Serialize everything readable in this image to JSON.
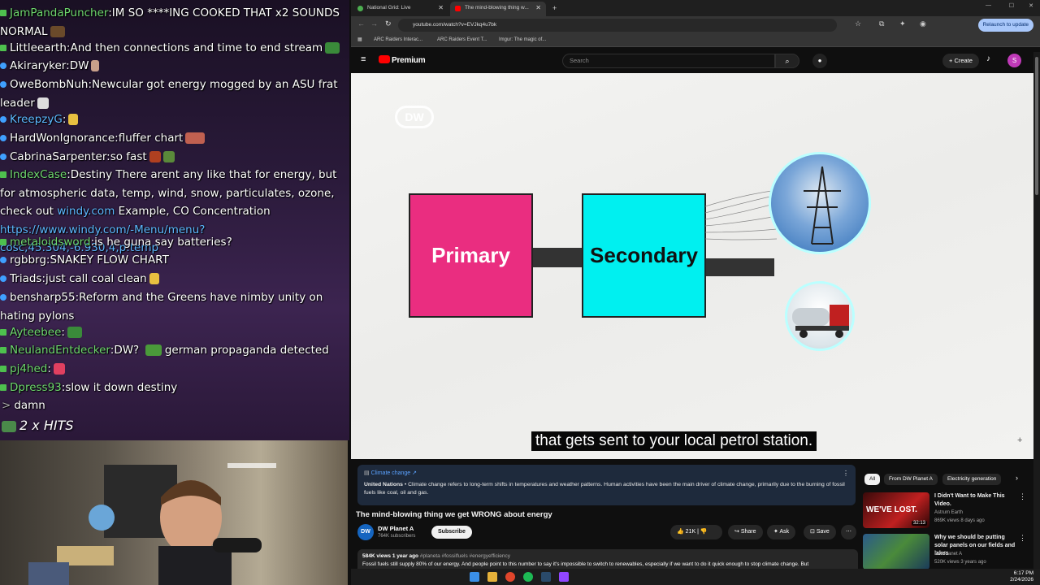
{
  "chat": {
    "messages": [
      {
        "user": "JamPandaPuncher",
        "text": "IM SO ****ING COOKED THAT x2 SOUNDS NORMAL",
        "color": "#6ed86e"
      },
      {
        "user": "Littleearth",
        "text": "And then connections and time to end stream",
        "color": "#ffffff"
      },
      {
        "user": "Akiraryker",
        "text": "DW",
        "color": "#ffffff"
      },
      {
        "user": "OweBombNuh",
        "text": "Newcular got energy mogged by an ASU frat leader",
        "color": "#ffffff"
      },
      {
        "user": "KreepzyG",
        "text": "",
        "color": "#5cb8ff"
      },
      {
        "user": "HardWonIgnorance",
        "text": "fluffer chart",
        "color": "#ffffff"
      },
      {
        "user": "CabrinaSarpenter",
        "text": "so fast",
        "color": "#ffffff"
      },
      {
        "user": "IndexCase",
        "text": "Destiny There arent any like that for energy, but for atmospheric data, temp, wind, snow, particulates, ozone, check out",
        "link1": "windy.com",
        "text2": "Example, CO Concentration",
        "link2": "https://www.windy.com/-Menu/menu?cosc,45.304,-6.930,4,p:temp",
        "color": "#6ed86e"
      },
      {
        "user": "metaloidsword",
        "text": "is he guna say batteries?",
        "color": "#6ed86e"
      },
      {
        "user": "rgbbrg",
        "text": "SNAKEY FLOW CHART",
        "color": "#ffffff"
      },
      {
        "user": "Triads",
        "text": "just call coal clean",
        "color": "#ffffff"
      },
      {
        "user": "bensharp55",
        "text": "Reform and the Greens have nimby unity on hating pylons",
        "color": "#ffffff"
      },
      {
        "user": "Ayteebee",
        "text": "",
        "color": "#6ed86e"
      },
      {
        "user": "NeulandEntdecker",
        "text": "DW?",
        "text2": "german propaganda detected",
        "color": "#6ed86e"
      },
      {
        "user": "pj4hed",
        "text": "",
        "color": "#6ed86e"
      },
      {
        "user": "Dpress93",
        "text": "slow it down destiny",
        "color": "#6ed86e"
      },
      {
        "user": "",
        "text": "damn",
        "color": "#ffffff"
      }
    ],
    "hits": "2 x HITS"
  },
  "browser": {
    "tabs": [
      "National Grid: Live",
      "The mind-blowing thing w..."
    ],
    "new_tab": "+",
    "url": "youtube.com/watch?v=EVJkq4u7bk",
    "relaunch": "Relaunch to update",
    "bookmarks": [
      "ARC Raiders Interac...",
      "ARC Raiders Event T...",
      "Imgur: The magic of..."
    ]
  },
  "youtube": {
    "logo": "Premium",
    "search_placeholder": "Search",
    "create": "Create",
    "avatar": "S",
    "video": {
      "watermark": "DW",
      "primary": "Primary",
      "secondary": "Secondary",
      "subtitle": "that gets sent to your local petrol station."
    },
    "info_panel": {
      "heading": "Climate change",
      "source": "United Nations",
      "text": "Climate change refers to long-term shifts in temperatures and weather patterns. Human activities have been the main driver of climate change, primarily due to the burning of fossil fuels like coal, oil and gas."
    },
    "title": "The mind-blowing thing we get WRONG about energy",
    "channel": {
      "logo": "DW",
      "name": "DW Planet A",
      "subs": "764K subscribers",
      "subscribe": "Subscribe"
    },
    "actions": {
      "likes": "21K",
      "share": "Share",
      "ask": "Ask",
      "save": "Save"
    },
    "description": {
      "meta": "584K views  1 year ago",
      "tags": "#planeta #fossilfuels #energyefficiency",
      "text": "Fossil fuels still supply 80% of our energy. And people point to this number to say it's impossible to switch to renewables, especially if we want to do it quick enough to stop climate change. But"
    },
    "chips": [
      "All",
      "From DW Planet A",
      "Electricity generation"
    ],
    "recommended": [
      {
        "title": "I Didn't Want to Make This Video.",
        "channel": "Astrum Earth",
        "meta": "869K views  8 days ago",
        "duration": "32:13",
        "thumb_text": "WE'VE LOST."
      },
      {
        "title": "Why we should be putting solar panels on our fields and lakes",
        "channel": "DW Planet A",
        "meta": "520K views  3 years ago",
        "duration": "",
        "thumb_text": ""
      }
    ]
  },
  "taskbar": {
    "time": "6:17 PM",
    "date": "2/24/2026"
  }
}
